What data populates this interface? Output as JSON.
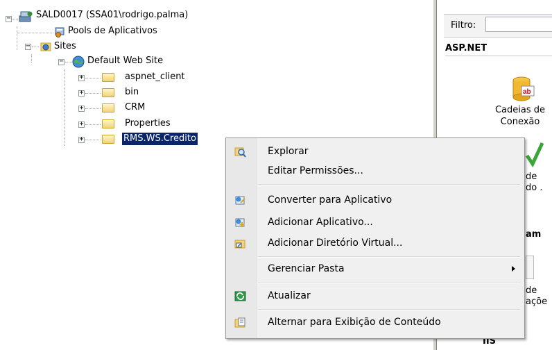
{
  "tree": {
    "server": "SALD0017 (SSA01\\rodrigo.palma)",
    "app_pools": "Pools de Aplicativos",
    "sites": "Sites",
    "default_site": "Default Web Site",
    "folders": [
      "aspnet_client",
      "bin",
      "CRM",
      "Properties",
      "RMS.WS.Credito"
    ],
    "selected": "RMS.WS.Credito",
    "expand_plus": "+",
    "expand_minus": "−"
  },
  "right_pane": {
    "filter_label": "Filtro:",
    "section_aspnet": "ASP.NET",
    "feature_1_line1": "Cadeias de",
    "feature_1_line2": "Conexão",
    "feature_1_icon_text": "ab",
    "partial_text_1": "de",
    "partial_text_2": "do .",
    "partial_text_3": "am",
    "partial_text_4": "de",
    "partial_text_5": "açõe",
    "section_iis": "IIS"
  },
  "context_menu": {
    "items": [
      {
        "label": "Explorar",
        "icon": "explore-icon"
      },
      {
        "label": "Editar Permissões...",
        "icon": ""
      },
      {
        "label": "Converter para Aplicativo",
        "icon": "convert-app-icon"
      },
      {
        "label": "Adicionar Aplicativo...",
        "icon": "add-app-icon"
      },
      {
        "label": "Adicionar Diretório Virtual...",
        "icon": "add-virtual-dir-icon"
      },
      {
        "label": "Gerenciar Pasta",
        "icon": "",
        "submenu": true
      },
      {
        "label": "Atualizar",
        "icon": "refresh-icon"
      },
      {
        "label": "Alternar para Exibição de Conteúdo",
        "icon": "content-view-icon"
      }
    ]
  },
  "colors": {
    "selection": "#0a246a",
    "menu_bg": "#f0f0f0",
    "folder": "#f2d27a"
  }
}
